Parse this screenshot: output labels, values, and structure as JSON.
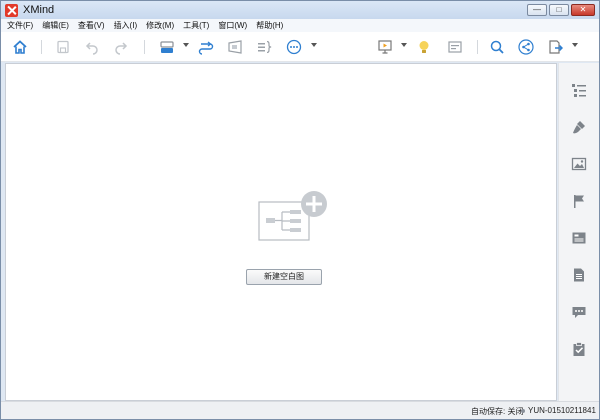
{
  "window": {
    "title": "XMind"
  },
  "menu": [
    "文件(F)",
    "编辑(E)",
    "查看(V)",
    "插入(I)",
    "修改(M)",
    "工具(T)",
    "窗口(W)",
    "帮助(H)"
  ],
  "toolbar": {
    "icons": [
      "home-icon",
      "save-icon",
      "undo-icon",
      "redo-icon",
      "structure-icon",
      "relationship-icon",
      "boundary-icon",
      "summary-icon",
      "more-icon",
      "presentation-icon",
      "brainstorm-icon",
      "outline-view-icon",
      "search-icon",
      "share-icon",
      "export-icon"
    ]
  },
  "canvas": {
    "new_blank_label": "新建空白图"
  },
  "sidebar": {
    "icons": [
      "outline-icon",
      "format-brush-icon",
      "image-icon",
      "marker-flag-icon",
      "notes-icon",
      "document-icon",
      "comment-icon",
      "task-clipboard-icon"
    ]
  },
  "status": {
    "autosave": "自动保存: 关闭",
    "user": "YUN-01510211841"
  },
  "colors": {
    "accent": "#2f7fd0",
    "brand": "#e23a2b",
    "icon_gray": "#8b9097"
  }
}
